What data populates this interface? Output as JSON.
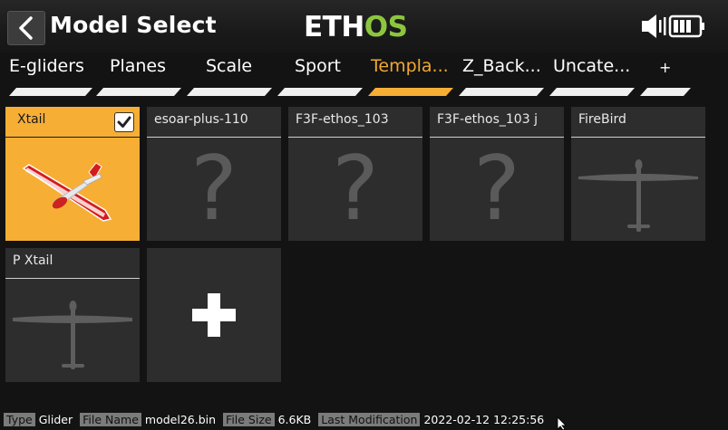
{
  "header": {
    "title": "Model Select",
    "logo_text": "ETHOS",
    "back_icon": "chevron-left-icon",
    "speaker_icon": "speaker-icon",
    "battery_icon": "battery-icon"
  },
  "tabs": [
    {
      "label": "E-gliders",
      "active": false
    },
    {
      "label": "Planes",
      "active": false
    },
    {
      "label": "Scale",
      "active": false
    },
    {
      "label": "Sport",
      "active": false
    },
    {
      "label": "Templa...",
      "active": true
    },
    {
      "label": "Z_Back...",
      "active": false
    },
    {
      "label": "Uncate...",
      "active": false
    },
    {
      "label": "+",
      "active": false
    }
  ],
  "models": [
    {
      "name": "Xtail",
      "selected": true,
      "image": "glider-red-photo"
    },
    {
      "name": "esoar-plus-110",
      "selected": false,
      "image": "question-mark"
    },
    {
      "name": "F3F-ethos_103",
      "selected": false,
      "image": "question-mark"
    },
    {
      "name": "F3F-ethos_103 j",
      "selected": false,
      "image": "question-mark"
    },
    {
      "name": "FireBird",
      "selected": false,
      "image": "glider-silhouette"
    },
    {
      "name": "P Xtail",
      "selected": false,
      "image": "glider-silhouette"
    }
  ],
  "add_model": {
    "glyph": "+"
  },
  "question_glyph": "?",
  "footer": {
    "type_label": "Type",
    "type_value": "Glider",
    "file_name_label": "File Name",
    "file_name_value": "model26.bin",
    "file_size_label": "File Size",
    "file_size_value": "6.6KB",
    "last_mod_label": "Last Modification",
    "last_mod_value": "2022-02-12 12:25:56"
  },
  "colors": {
    "accent": "#f6ae35",
    "card_bg": "#2d2d2d",
    "background": "#131313",
    "logo_green": "#8cc63f"
  }
}
